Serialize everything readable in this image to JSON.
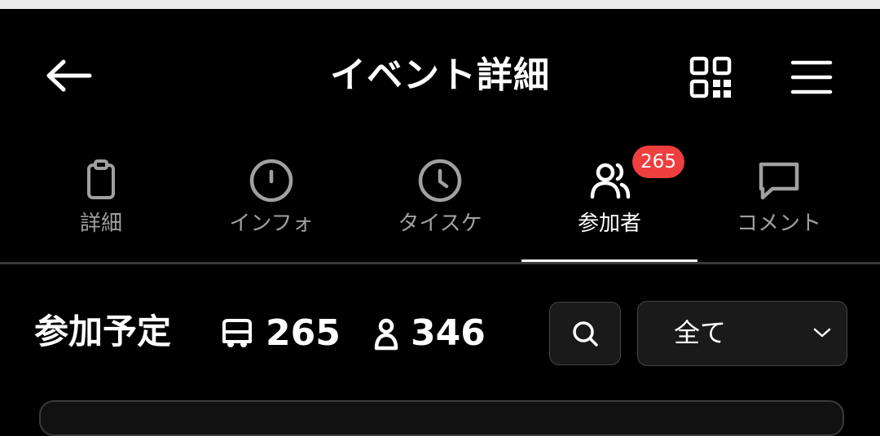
{
  "header": {
    "title": "イベント詳細",
    "back_icon": "arrow-left-icon",
    "qr_icon": "qr-code-icon",
    "menu_icon": "hamburger-menu-icon"
  },
  "tabs": [
    {
      "label": "詳細",
      "icon": "clipboard-icon",
      "active": false
    },
    {
      "label": "インフォ",
      "icon": "info-circle-icon",
      "active": false
    },
    {
      "label": "タイスケ",
      "icon": "clock-icon",
      "active": false
    },
    {
      "label": "参加者",
      "icon": "users-icon",
      "active": true,
      "badge": "265"
    },
    {
      "label": "コメント",
      "icon": "chat-bubble-icon",
      "active": false
    }
  ],
  "summary": {
    "title": "参加予定",
    "groups_count": "265",
    "groups_icon": "bus-icon",
    "people_count": "346",
    "people_icon": "person-icon"
  },
  "filter": {
    "search_icon": "search-icon",
    "selected": "全て",
    "dropdown_icon": "chevron-down-icon"
  },
  "colors": {
    "background": "#000000",
    "badge": "#ef3e3e",
    "inactive_text": "#a0a0a0",
    "active_text": "#ffffff"
  }
}
